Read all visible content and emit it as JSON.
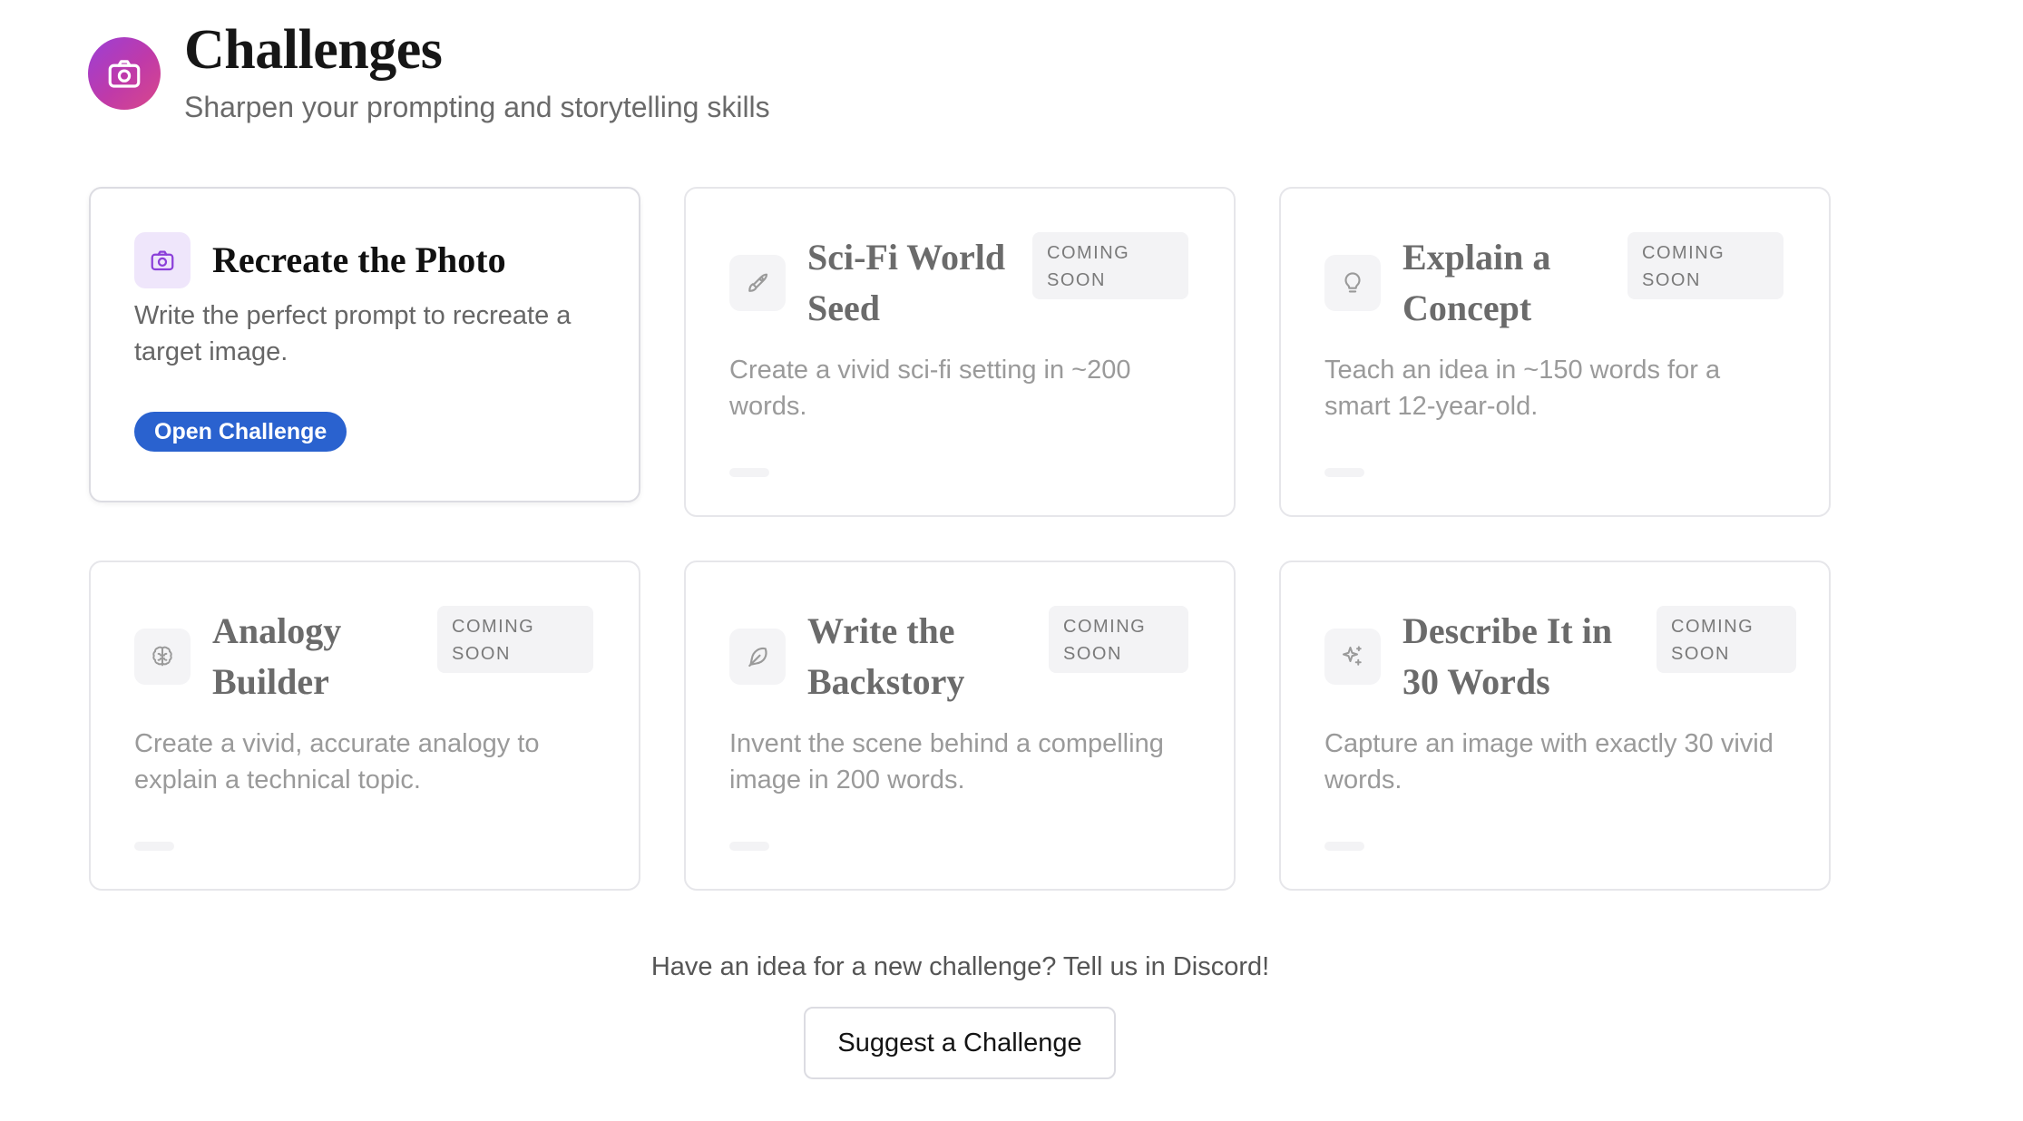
{
  "header": {
    "title": "Challenges",
    "subtitle": "Sharpen your prompting and storytelling skills",
    "logo_icon": "camera-icon",
    "logo_gradient": [
      "#9b3fd6",
      "#d9488a"
    ]
  },
  "cards": [
    {
      "title": "Recreate the Photo",
      "description": "Write the perfect prompt to recreate a target image.",
      "icon": "camera-icon",
      "button_label": "Open Challenge",
      "status": "active"
    },
    {
      "title": "Sci-Fi World Seed",
      "description": "Create a vivid sci-fi setting in ~200 words.",
      "icon": "rocket-icon",
      "badge": "COMING SOON"
    },
    {
      "title": "Explain a Concept",
      "description": "Teach an idea in ~150 words for a smart 12-year-old.",
      "icon": "lightbulb-icon",
      "badge": "COMING SOON"
    },
    {
      "title": "Analogy Builder",
      "description": "Create a vivid, accurate analogy to explain a technical topic.",
      "icon": "brain-icon",
      "badge": "COMING SOON"
    },
    {
      "title": "Write the Backstory",
      "description": "Invent the scene behind a compelling image in 200 words.",
      "icon": "feather-icon",
      "badge": "COMING SOON"
    },
    {
      "title": "Describe It in 30 Words",
      "description": "Capture an image with exactly 30 vivid words.",
      "icon": "sparkles-icon",
      "badge": "COMING SOON"
    }
  ],
  "footer": {
    "prompt": "Have an idea for a new challenge? Tell us in Discord!",
    "button_label": "Suggest a Challenge"
  },
  "colors": {
    "primary_button": "#2a62cf",
    "active_icon": "#8b3fd9",
    "muted_text": "#9a9a9a"
  }
}
